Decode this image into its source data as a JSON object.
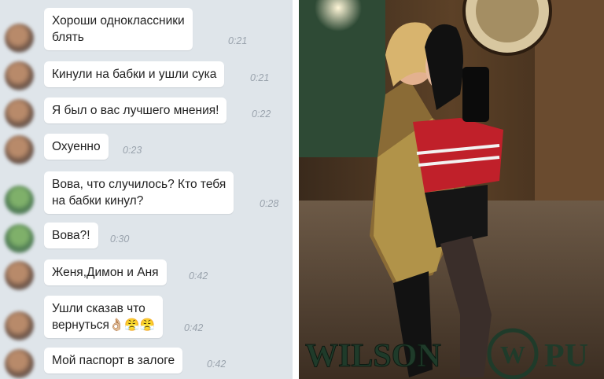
{
  "chat": {
    "messages": [
      {
        "text": "Хороши одноклассники\nблять",
        "time": "0:21"
      },
      {
        "text": "Кинули на бабки и ушли сука",
        "time": "0:21"
      },
      {
        "text": "Я был о вас лучшего мнения!",
        "time": "0:22"
      },
      {
        "text": "Охуенно",
        "time": "0:23"
      },
      {
        "text": "Вова, что случилось? Кто тебя\nна бабки кинул?",
        "time": "0:28"
      },
      {
        "text": "Вова?!",
        "time": "0:30"
      },
      {
        "text": "Женя,Димон и Аня",
        "time": "0:42"
      },
      {
        "text": "Ушли сказав что\nвернуться👌🏼😤😤",
        "time": "0:42"
      },
      {
        "text": "Мой паспорт в залоге",
        "time": "0:42"
      }
    ]
  },
  "photo": {
    "sign_text": "WILSON",
    "sign_text_right": "PU",
    "logo_letter": "W"
  }
}
